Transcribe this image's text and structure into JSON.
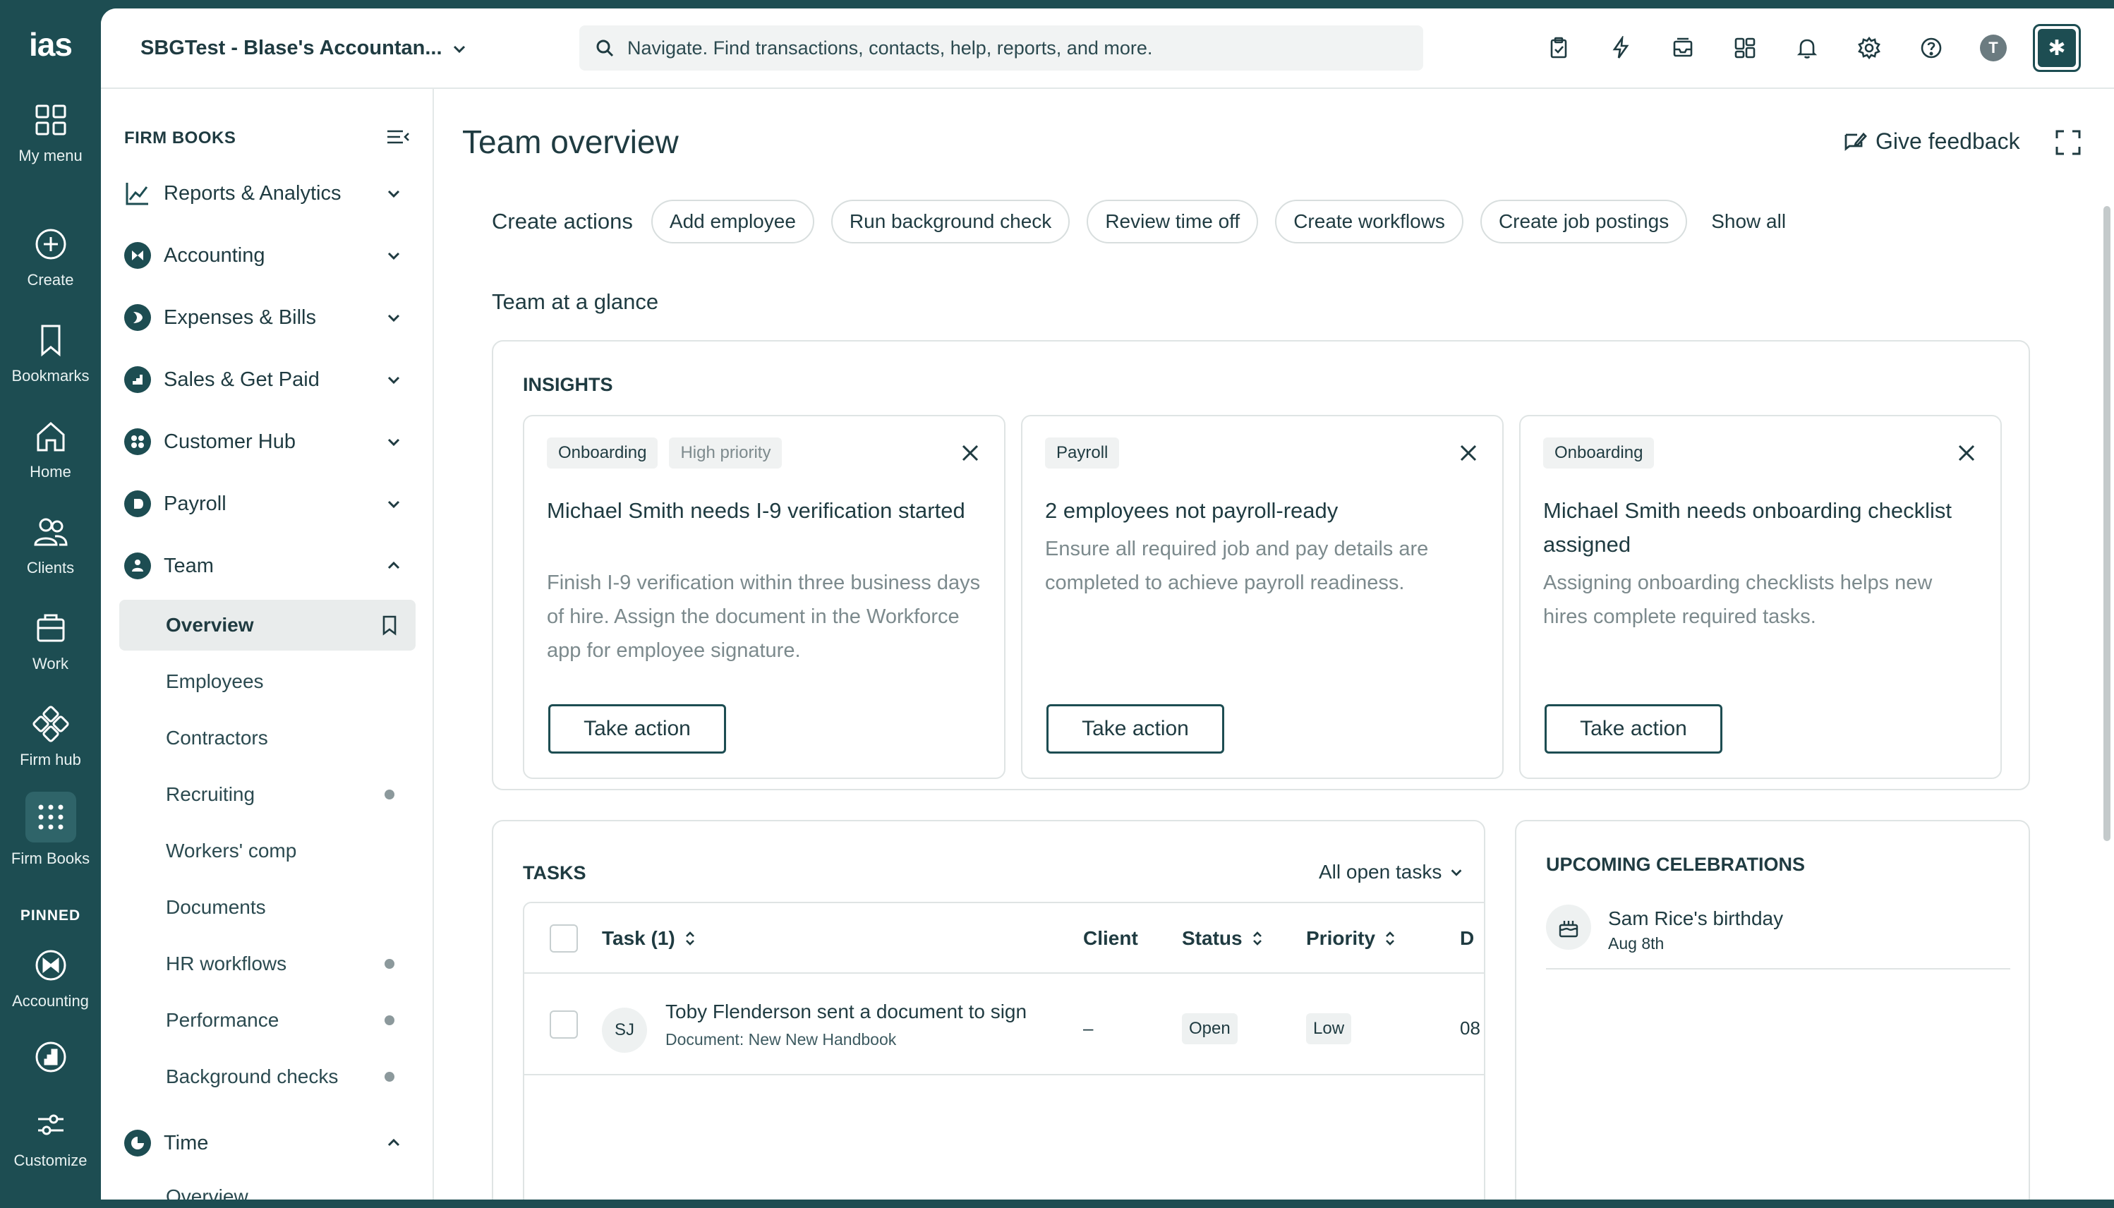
{
  "rail": {
    "logo": "ias",
    "items": [
      {
        "label": "My menu",
        "icon": "grid-icon"
      },
      {
        "label": "Create",
        "icon": "plus-circle-icon"
      },
      {
        "label": "Bookmarks",
        "icon": "bookmark-icon"
      },
      {
        "label": "Home",
        "icon": "home-icon"
      },
      {
        "label": "Clients",
        "icon": "clients-icon"
      },
      {
        "label": "Work",
        "icon": "work-icon"
      },
      {
        "label": "Firm hub",
        "icon": "firm-hub-icon"
      },
      {
        "label": "Firm Books",
        "icon": "apps-grid-icon"
      }
    ],
    "pinned_label": "PINNED",
    "pinned": [
      {
        "label": "Accounting",
        "icon": "accounting-icon"
      },
      {
        "label": "",
        "icon": "chart-app-icon"
      }
    ],
    "customize_label": "Customize"
  },
  "topbar": {
    "company": "SBGTest - Blase's Accountan...",
    "search_placeholder": "Navigate. Find transactions, contacts, help, reports, and more."
  },
  "sidebar": {
    "heading": "FIRM BOOKS",
    "sections": [
      {
        "label": "Reports & Analytics"
      },
      {
        "label": "Accounting"
      },
      {
        "label": "Expenses & Bills"
      },
      {
        "label": "Sales & Get Paid"
      },
      {
        "label": "Customer Hub"
      },
      {
        "label": "Payroll"
      },
      {
        "label": "Team"
      }
    ],
    "team_sub": [
      {
        "label": "Overview"
      },
      {
        "label": "Employees"
      },
      {
        "label": "Contractors"
      },
      {
        "label": "Recruiting"
      },
      {
        "label": "Workers' comp"
      },
      {
        "label": "Documents"
      },
      {
        "label": "HR workflows"
      },
      {
        "label": "Performance"
      },
      {
        "label": "Background checks"
      }
    ],
    "time_section": {
      "label": "Time"
    },
    "time_sub": [
      {
        "label": "Overview"
      }
    ]
  },
  "main": {
    "title": "Team overview",
    "feedback": "Give feedback",
    "create_actions_label": "Create actions",
    "actions": [
      "Add employee",
      "Run background check",
      "Review time off",
      "Create workflows",
      "Create job postings"
    ],
    "show_all": "Show all",
    "glance": "Team at a glance",
    "insights_heading": "INSIGHTS",
    "insights": [
      {
        "tags": [
          "Onboarding",
          "High priority"
        ],
        "title": "Michael Smith needs I-9 verification started",
        "body": "Finish I-9 verification within three business days of hire. Assign the document in the Workforce app for employee signature.",
        "action": "Take action"
      },
      {
        "tags": [
          "Payroll"
        ],
        "title": "2 employees not payroll-ready",
        "body": "Ensure all required job and pay details are completed to achieve payroll readiness.",
        "action": "Take action"
      },
      {
        "tags": [
          "Onboarding"
        ],
        "title": "Michael Smith needs onboarding checklist assigned",
        "body": "Assigning onboarding checklists helps new hires complete required tasks.",
        "action": "Take action"
      }
    ],
    "tasks": {
      "heading": "TASKS",
      "filter": "All open tasks",
      "columns": [
        "Task (1)",
        "Client",
        "Status",
        "Priority",
        "D"
      ],
      "rows": [
        {
          "initials": "SJ",
          "title": "Toby Flenderson sent a document to sign",
          "subtitle": "Document: New New Handbook",
          "client": "–",
          "status": "Open",
          "priority": "Low",
          "due": "08"
        }
      ]
    },
    "celebrations": {
      "heading": "UPCOMING CELEBRATIONS",
      "items": [
        {
          "name": "Sam Rice's birthday",
          "date": "Aug 8th"
        }
      ]
    }
  }
}
